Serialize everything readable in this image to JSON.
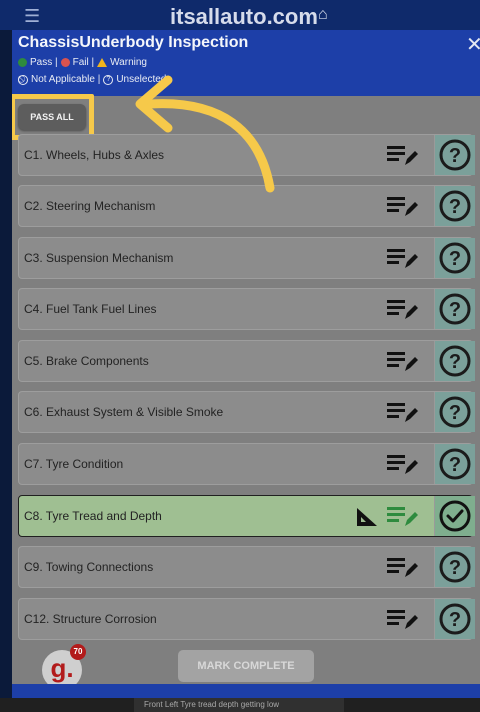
{
  "topbar": {
    "brand": "itsallauto.com"
  },
  "modal": {
    "title": "ChassisUnderbody Inspection",
    "legend": {
      "pass": "Pass |",
      "fail": "Fail |",
      "warning": "Warning",
      "not_applicable": "Not Applicable |",
      "unselected": "Unselected"
    },
    "pass_all_label": "PASS ALL",
    "items": [
      {
        "label": "C1. Wheels, Hubs & Axles",
        "status": "unselected"
      },
      {
        "label": "C2. Steering Mechanism",
        "status": "unselected"
      },
      {
        "label": "C3. Suspension Mechanism",
        "status": "unselected"
      },
      {
        "label": "C4. Fuel Tank Fuel Lines",
        "status": "unselected"
      },
      {
        "label": "C5. Brake Components",
        "status": "unselected"
      },
      {
        "label": "C6. Exhaust System & Visible Smoke",
        "status": "unselected"
      },
      {
        "label": "C7. Tyre Condition",
        "status": "unselected"
      },
      {
        "label": "C8. Tyre Tread and Depth",
        "status": "pass"
      },
      {
        "label": "C9. Towing Connections",
        "status": "unselected"
      },
      {
        "label": "C12. Structure Corrosion",
        "status": "unselected"
      }
    ],
    "mark_complete_label": "MARK COMPLETE",
    "badge": {
      "letter": "g.",
      "count": "70"
    }
  },
  "bottom_note": "Front Left Tyre tread depth getting low",
  "colors": {
    "header": "#1d3fa8",
    "pass": "#2e8b3e",
    "fail": "#d9534f",
    "warning": "#f0b51c",
    "highlight": "#f6c94a"
  },
  "icons": {
    "notes": "notes-edit-icon",
    "unselected": "question-circle-icon",
    "pass": "check-circle-icon",
    "measure": "measure-ruler-icon"
  }
}
